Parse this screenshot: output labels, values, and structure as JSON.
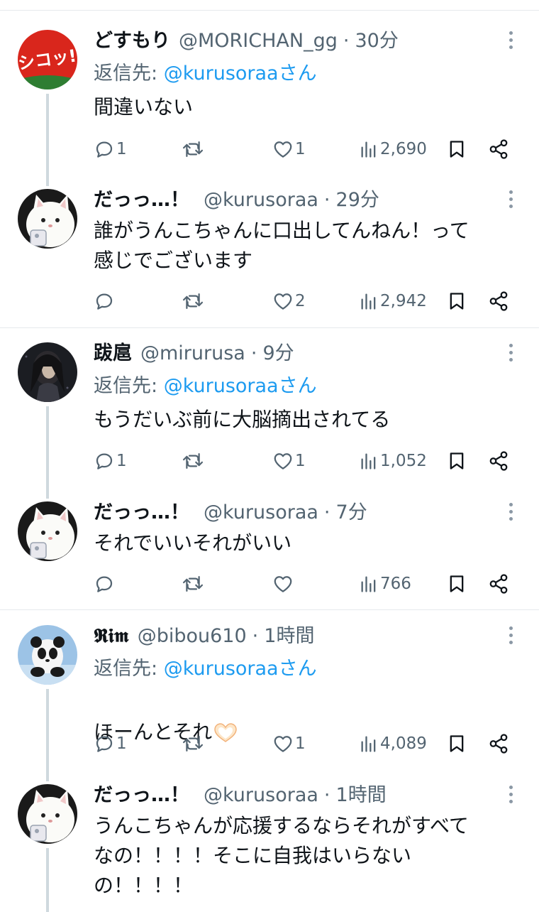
{
  "tweets": [
    {
      "name": "どすもり",
      "handle": "@MORICHAN_gg",
      "time": "30分",
      "reply_prefix": "返信先: ",
      "reply_mention": "@kurusoraaさん",
      "text": "間違いない",
      "replies": "1",
      "retweets": "",
      "likes": "1",
      "views": "2,690",
      "avatar": "shikoku-logo-avatar"
    },
    {
      "name": "だっっ…！",
      "handle": "@kurusoraa",
      "time": "29分",
      "reply_prefix": "",
      "reply_mention": "",
      "text": "誰がうんこちゃんに口出してんねん！って\n感じでございます",
      "replies": "",
      "retweets": "",
      "likes": "2",
      "views": "2,942",
      "avatar": "white-cat-avatar"
    },
    {
      "name": "跋扈",
      "handle": "@mirurusa",
      "time": "9分",
      "reply_prefix": "返信先: ",
      "reply_mention": "@kurusoraaさん",
      "text": "もうだいぶ前に大脳摘出されてる",
      "replies": "1",
      "retweets": "",
      "likes": "1",
      "views": "1,052",
      "avatar": "dark-girl-avatar"
    },
    {
      "name": "だっっ…！",
      "handle": "@kurusoraa",
      "time": "7分",
      "reply_prefix": "",
      "reply_mention": "",
      "text": "それでいいそれがいい",
      "replies": "",
      "retweets": "",
      "likes": "",
      "views": "766",
      "avatar": "white-cat-avatar"
    },
    {
      "name": "𝕽𝖎𝖒",
      "handle": "@bibou610",
      "time": "1時間",
      "reply_prefix": "返信先: ",
      "reply_mention": "@kurusoraaさん",
      "text": "ほーんとそれ",
      "replies": "1",
      "retweets": "",
      "likes": "1",
      "views": "4,089",
      "avatar": "panda-avatar"
    },
    {
      "name": "だっっ…！",
      "handle": "@kurusoraa",
      "time": "1時間",
      "reply_prefix": "",
      "reply_mention": "",
      "text": "うんこちゃんが応援するならそれがすべて\nなの！！！！そこに自我はいらない\nの！！！！",
      "replies": "",
      "retweets": "",
      "likes": "",
      "views": "",
      "avatar": "white-cat-avatar"
    }
  ],
  "dot": "·",
  "colors": {
    "text": "#0f1419",
    "secondary": "#536471",
    "link": "#1d9bf0",
    "thread_line": "#cfd9de",
    "separator": "#e6e9ec"
  }
}
